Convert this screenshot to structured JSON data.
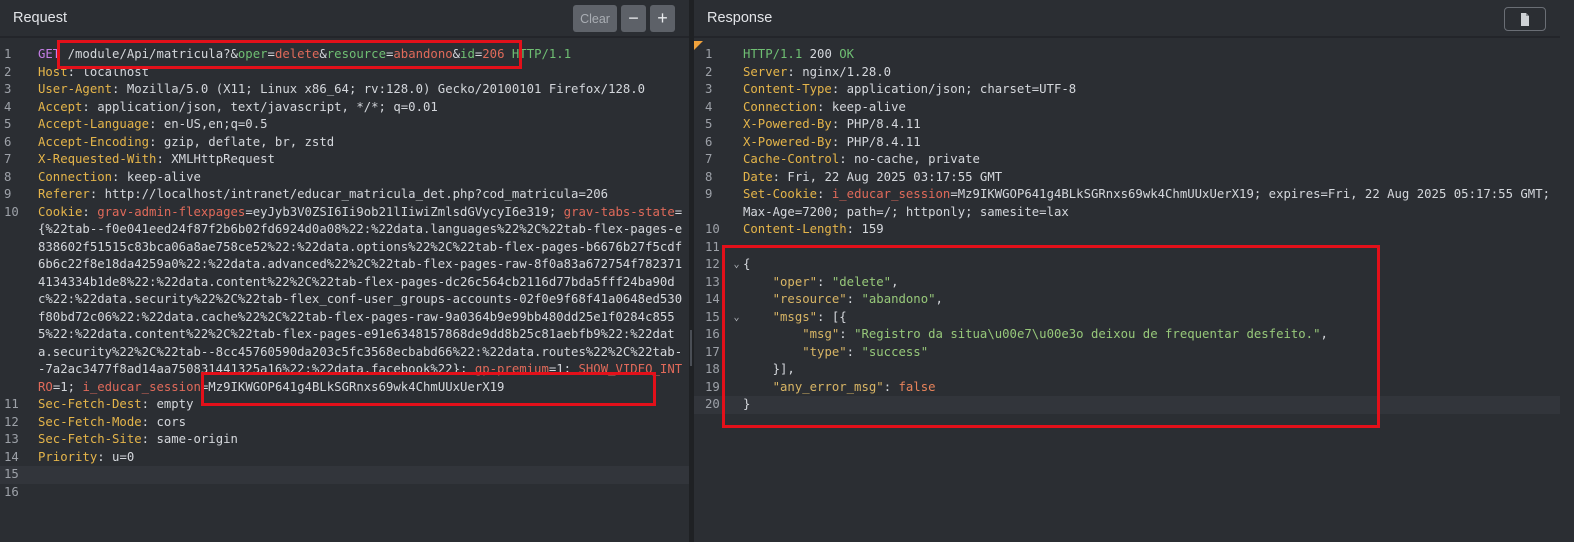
{
  "request": {
    "title": "Request",
    "clear_label": "Clear",
    "minus_label": "−",
    "plus_label": "+",
    "lines": [
      {
        "n": "1",
        "html": "<span class='m'>GET</span> /module/Api/matricula?&amp;<span class='pn'>oper</span>=<span class='pv'>delete</span>&amp;<span class='pn'>resource</span>=<span class='pv'>abandono</span>&amp;<span class='pn'>id</span>=<span class='pv'>206</span> <span class='hv'>HTTP/1.1</span>"
      },
      {
        "n": "2",
        "html": "<span class='k'>Host</span>: localhost"
      },
      {
        "n": "3",
        "html": "<span class='k'>User-Agent</span>: Mozilla/5.0 (X11; Linux x86_64; rv:128.0) Gecko/20100101 Firefox/128.0"
      },
      {
        "n": "4",
        "html": "<span class='k'>Accept</span>: application/json, text/javascript, */*; q=0.01"
      },
      {
        "n": "5",
        "html": "<span class='k'>Accept-Language</span>: en-US,en;q=0.5"
      },
      {
        "n": "6",
        "html": "<span class='k'>Accept-Encoding</span>: gzip, deflate, br, zstd"
      },
      {
        "n": "7",
        "html": "<span class='k'>X-Requested-With</span>: XMLHttpRequest"
      },
      {
        "n": "8",
        "html": "<span class='k'>Connection</span>: keep-alive"
      },
      {
        "n": "9",
        "html": "<span class='k'>Referer</span>: http://localhost/intranet/educar_matricula_det.php?cod_matricula=206"
      },
      {
        "n": "10",
        "html": "<span class='k'>Cookie</span>: <span class='ck'>grav-admin-flexpages</span>=eyJyb3V0ZSI6Ii9ob21lIiwiZmlsdGVycyI6e319; <span class='ck'>grav-tabs-state</span>={%22tab--f0e041eed24f87f2b6b02fd6924d0a08%22:%22data.languages%22%2C%22tab-flex-pages-e838602f51515c83bca06a8ae758ce52%22:%22data.options%22%2C%22tab-flex-pages-b6676b27f5cdf6b6c22f8e18da4259a0%22:%22data.advanced%22%2C%22tab-flex-pages-raw-8f0a83a672754f7823714134334b1de8%22:%22data.content%22%2C%22tab-flex-pages-dc26c564cb2116d77bda5fff24ba90dc%22:%22data.security%22%2C%22tab-flex_conf-user_groups-accounts-02f0e9f68f41a0648ed530f80bd72c06%22:%22data.cache%22%2C%22tab-flex-pages-raw-9a0364b9e99bb480dd25e1f0284c8555%22:%22data.content%22%2C%22tab-flex-pages-e91e6348157868de9dd8b25c81aebfb9%22:%22data.security%22%2C%22tab--8cc45760590da203c5fc3568ecbabd66%22:%22data.routes%22%2C%22tab--7a2ac3477f8ad14aa750831441325a16%22:%22data.facebook%22}; <span class='ck'>gp-premium</span>=1; <span class='ck'>SHOW_VIDEO_INTRO</span>=1; <span class='ck'>i_educar_session</span>=Mz9IKWGOP641g4BLkSGRnxs69wk4ChmUUxUerX19"
      },
      {
        "n": "11",
        "html": "<span class='k'>Sec-Fetch-Dest</span>: empty"
      },
      {
        "n": "12",
        "html": "<span class='k'>Sec-Fetch-Mode</span>: cors"
      },
      {
        "n": "13",
        "html": "<span class='k'>Sec-Fetch-Site</span>: same-origin"
      },
      {
        "n": "14",
        "html": "<span class='k'>Priority</span>: u=0"
      },
      {
        "n": "15",
        "html": "",
        "hl": true
      },
      {
        "n": "16",
        "html": ""
      }
    ]
  },
  "response": {
    "title": "Response",
    "lines": [
      {
        "n": "1",
        "html": "<span class='hv'>HTTP/1.1</span> 200 <span class='hv'>OK</span>"
      },
      {
        "n": "2",
        "html": "<span class='k'>Server</span>: nginx/1.28.0"
      },
      {
        "n": "3",
        "html": "<span class='k'>Content-Type</span>: application/json; charset=UTF-8"
      },
      {
        "n": "4",
        "html": "<span class='k'>Connection</span>: keep-alive"
      },
      {
        "n": "5",
        "html": "<span class='k'>X-Powered-By</span>: PHP/8.4.11"
      },
      {
        "n": "6",
        "html": "<span class='k'>X-Powered-By</span>: PHP/8.4.11"
      },
      {
        "n": "7",
        "html": "<span class='k'>Cache-Control</span>: no-cache, private"
      },
      {
        "n": "8",
        "html": "<span class='k'>Date</span>: Fri, 22 Aug 2025 03:17:55 GMT"
      },
      {
        "n": "9",
        "html": "<span class='k'>Set-Cookie</span>: <span class='ck'>i_educar_session</span>=Mz9IKWGOP641g4BLkSGRnxs69wk4ChmUUxUerX19; expires=Fri, 22 Aug 2025 05:17:55 GMT; Max-Age=7200; path=/; httponly; samesite=lax"
      },
      {
        "n": "10",
        "html": "<span class='k'>Content-Length</span>: 159"
      },
      {
        "n": "11",
        "html": ""
      },
      {
        "n": "12",
        "fold": "⌄",
        "html": "{"
      },
      {
        "n": "13",
        "html": "    <span class='js'>\"oper\"</span>: <span class='jv'>\"delete\"</span>,"
      },
      {
        "n": "14",
        "html": "    <span class='js'>\"resource\"</span>: <span class='jv'>\"abandono\"</span>,"
      },
      {
        "n": "15",
        "fold": "⌄",
        "html": "    <span class='js'>\"msgs\"</span>: [{"
      },
      {
        "n": "16",
        "html": "        <span class='js'>\"msg\"</span>: <span class='jv'>\"Registro da situa\\u00e7\\u00e3o deixou de frequentar desfeito.\"</span>,"
      },
      {
        "n": "17",
        "html": "        <span class='js'>\"type\"</span>: <span class='jv'>\"success\"</span>"
      },
      {
        "n": "18",
        "html": "    }],"
      },
      {
        "n": "19",
        "html": "    <span class='js'>\"any_error_msg\"</span>: <span class='jb'>false</span>"
      },
      {
        "n": "20",
        "html": "}",
        "hl": true
      }
    ]
  }
}
